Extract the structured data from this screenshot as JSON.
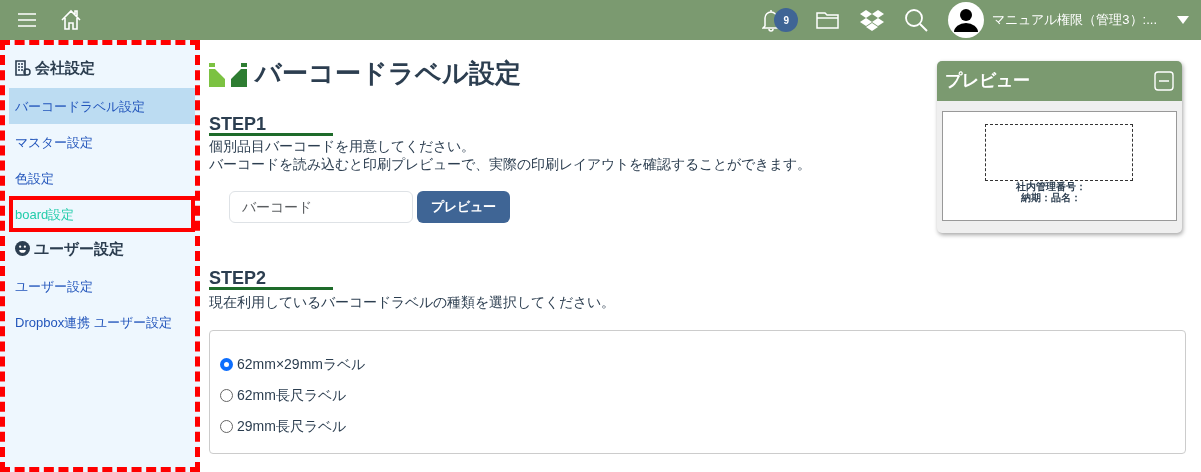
{
  "topbar": {
    "notification_count": "9",
    "user_name": "マニュアル権限（管理3）:..."
  },
  "sidebar": {
    "sections": [
      {
        "title": "会社設定",
        "kind": "company",
        "items": [
          {
            "label": "バーコードラベル設定",
            "selected": true,
            "highlighted": false
          },
          {
            "label": "マスター設定",
            "selected": false,
            "highlighted": false
          },
          {
            "label": "色設定",
            "selected": false,
            "highlighted": false
          },
          {
            "label": "board設定",
            "selected": false,
            "highlighted": true
          }
        ]
      },
      {
        "title": "ユーザー設定",
        "kind": "user",
        "items": [
          {
            "label": "ユーザー設定",
            "selected": false,
            "highlighted": false
          },
          {
            "label": "Dropbox連携 ユーザー設定",
            "selected": false,
            "highlighted": false
          }
        ]
      }
    ]
  },
  "page_title": "バーコードラベル設定",
  "step1": {
    "heading": "STEP1",
    "lines": [
      "個別品目バーコードを用意してください。",
      "バーコードを読み込むと印刷プレビューで、実際の印刷レイアウトを確認することができます。"
    ],
    "placeholder": "バーコード",
    "button": "プレビュー"
  },
  "step2": {
    "heading": "STEP2",
    "description": "現在利用しているバーコードラベルの種類を選択してください。",
    "options": [
      {
        "label": "62mm×29mmラベル",
        "selected": true
      },
      {
        "label": "62mm長尺ラベル",
        "selected": false
      },
      {
        "label": "29mm長尺ラベル",
        "selected": false
      }
    ]
  },
  "preview": {
    "title": "プレビュー",
    "label_lines": [
      "社内管理番号：",
      "納期：品名："
    ]
  }
}
